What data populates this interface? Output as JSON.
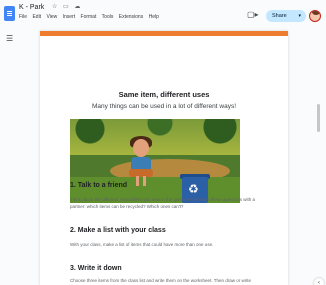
{
  "header": {
    "doc_title": "K - Park",
    "menu": [
      "File",
      "Edit",
      "View",
      "Insert",
      "Format",
      "Tools",
      "Extensions",
      "Help"
    ],
    "share_label": "Share"
  },
  "icons": {
    "docs": "docs-icon",
    "star": "star-icon",
    "folder": "folder-icon",
    "cloud": "cloud-icon",
    "meet": "meet-icon",
    "outline": "outline-icon",
    "chevron": "chevron-down-icon",
    "side_panel": "chevron-left-icon"
  },
  "glyphs": {
    "title_icons": "☆ ▭ ☁",
    "meet": "▢▸",
    "caret": "▾",
    "outline": "☰",
    "recycle": "♻",
    "side": "‹"
  },
  "colors": {
    "accent": "#ee7d30",
    "share_bg": "#c2e7ff",
    "docs_blue": "#4285f4",
    "bin_blue": "#2b5fa6"
  },
  "document": {
    "title": "Same item, different uses",
    "subtitle": "Many things can be used in a lot of different ways!",
    "sections": [
      {
        "heading": "1. Talk to a friend",
        "body": "Think about the different recyclables you saw in the game and answer these questions with a partner: which items can be recycled? Which ones can't?"
      },
      {
        "heading": "2. Make a list with your class",
        "body": "With your class, make a list of items that could have more than one use."
      },
      {
        "heading": "3. Write it down",
        "body": "Choose three items from the class list and write them on the worksheet. Then draw or write another way each item can be used."
      }
    ]
  }
}
